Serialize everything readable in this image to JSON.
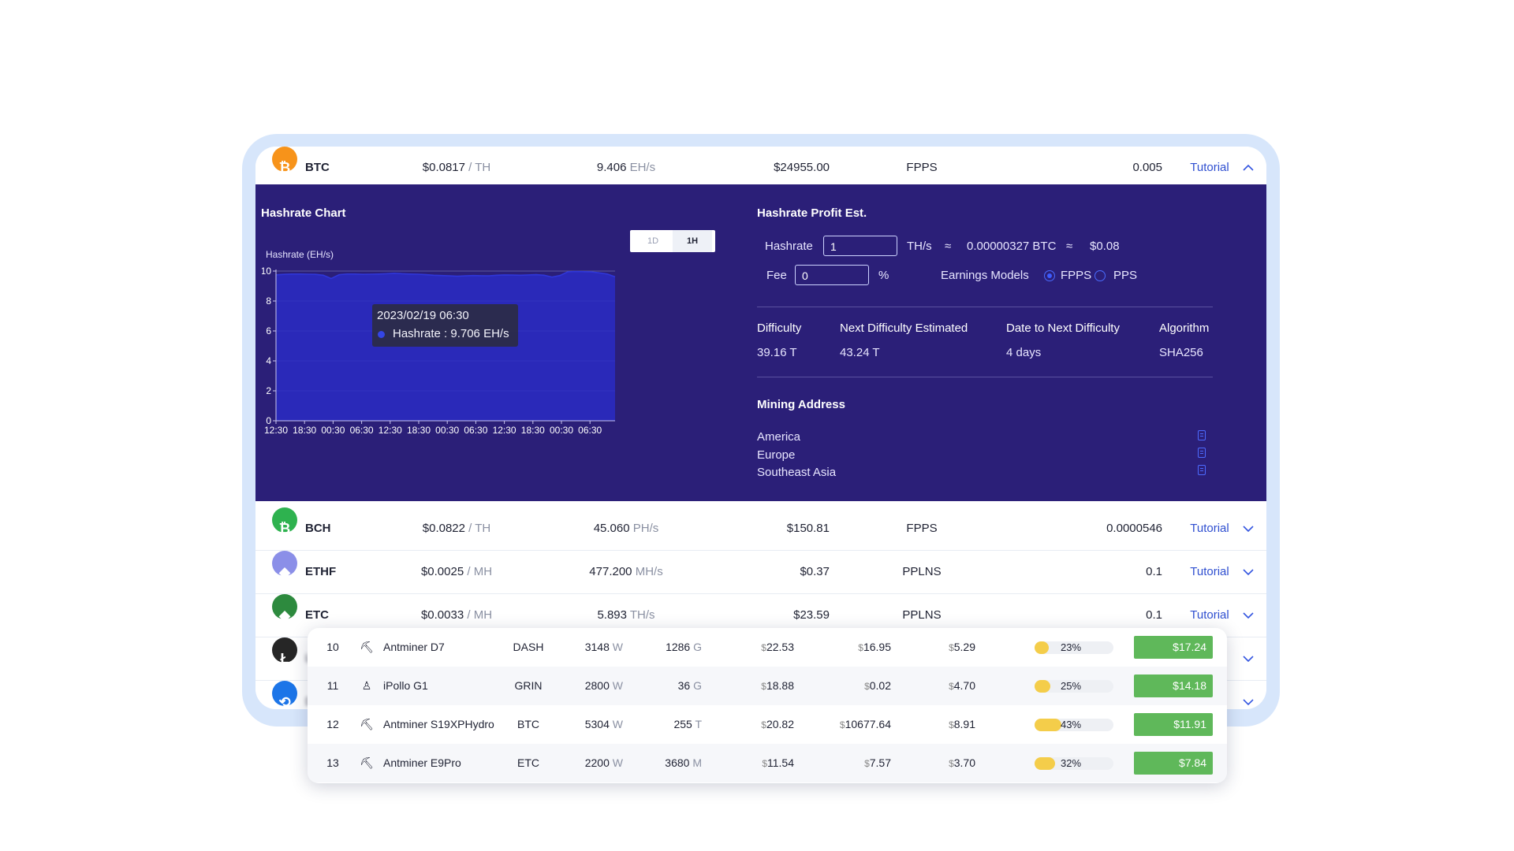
{
  "coins": [
    {
      "name": "BTC",
      "price": "$0.0817",
      "price_unit": "/ TH",
      "hashrate": "9.406",
      "hashrate_unit": "EH/s",
      "usd": "$24955.00",
      "model": "FPPS",
      "min_payout": "0.005",
      "tutorial": "Tutorial",
      "chevron": "^",
      "icon": "bitcoin-icon",
      "color": "#f7931a",
      "glyph": "₿"
    },
    {
      "name": "BCH",
      "price": "$0.0822",
      "price_unit": "/ TH",
      "hashrate": "45.060",
      "hashrate_unit": "PH/s",
      "usd": "$150.81",
      "model": "FPPS",
      "min_payout": "0.0000546",
      "tutorial": "Tutorial",
      "chevron": "v",
      "icon": "bitcoin-cash-icon",
      "color": "#2eb24f",
      "glyph": "₿"
    },
    {
      "name": "ETHF",
      "price": "$0.0025",
      "price_unit": "/ MH",
      "hashrate": "477.200",
      "hashrate_unit": "MH/s",
      "usd": "$0.37",
      "model": "PPLNS",
      "min_payout": "0.1",
      "tutorial": "Tutorial",
      "chevron": "v",
      "icon": "ethereum-fair-icon",
      "color": "#8b8fe8",
      "glyph": "◆"
    },
    {
      "name": "ETC",
      "price": "$0.0033",
      "price_unit": "/ MH",
      "hashrate": "5.893",
      "hashrate_unit": "TH/s",
      "usd": "$23.59",
      "model": "PPLNS",
      "min_payout": "0.1",
      "tutorial": "Tutorial",
      "chevron": "v",
      "icon": "ethereum-classic-icon",
      "color": "#2d8a3e",
      "glyph": "◆"
    },
    {
      "name": "L",
      "price": "",
      "price_unit": "",
      "hashrate": "",
      "hashrate_unit": "",
      "usd": "",
      "model": "",
      "min_payout": "",
      "tutorial": "",
      "chevron": "v",
      "icon": "litecoin-icon",
      "color": "#262626",
      "glyph": "Ł"
    },
    {
      "name": "D",
      "price": "",
      "price_unit": "",
      "hashrate": "",
      "hashrate_unit": "",
      "usd": "",
      "model": "",
      "min_payout": "",
      "tutorial": "",
      "chevron": "v",
      "icon": "dash-icon",
      "color": "#1c75e8",
      "glyph": "⟲"
    }
  ],
  "hashrate_chart": {
    "panel_title": "Hashrate Chart",
    "timeframes": [
      "1D",
      "1H"
    ],
    "selected_timeframe": "1H",
    "tooltip": {
      "date": "2023/02/19 06:30",
      "series_label": "Hashrate : 9.706 EH/s"
    }
  },
  "chart_data": {
    "type": "area",
    "title": "",
    "ylabel": "Hashrate (EH/s)",
    "xlabel": "",
    "ylim": [
      0,
      10
    ],
    "yticks": [
      0,
      2,
      4,
      6,
      8,
      10
    ],
    "x_tick_labels": [
      "12:30",
      "18:30",
      "00:30",
      "06:30",
      "12:30",
      "18:30",
      "00:30",
      "06:30",
      "12:30",
      "18:30",
      "00:30",
      "06:30"
    ],
    "series": [
      {
        "values": [
          9.75,
          9.78,
          9.8,
          9.8,
          9.79,
          9.78,
          9.72,
          9.5,
          9.76,
          9.8,
          9.8,
          9.78,
          9.79,
          9.8,
          9.82,
          9.85,
          9.82,
          9.8,
          9.79,
          9.76,
          9.72,
          9.7,
          9.68,
          9.65,
          9.68,
          9.7,
          9.69,
          9.68,
          9.72,
          9.74,
          9.73,
          9.72,
          9.74,
          9.76,
          9.72,
          9.6,
          9.7,
          9.95,
          9.97,
          9.96,
          9.94,
          9.88,
          9.8,
          9.62
        ]
      }
    ],
    "colors": {
      "fill": "#2a2cc4",
      "line": "#2f36d8",
      "grid": "#5c5a9c"
    }
  },
  "profit_est": {
    "title": "Hashrate Profit Est.",
    "hashrate_label": "Hashrate",
    "hashrate_value": "1",
    "hashrate_unit": "TH/s",
    "approx1": "≈",
    "btc_value": "0.00000327 BTC",
    "approx2": "≈",
    "usd_value": "$0.08",
    "fee_label": "Fee",
    "fee_value": "0",
    "fee_unit": "%",
    "earnings_label": "Earnings Models",
    "model_options": [
      "FPPS",
      "PPS"
    ],
    "selected_model": "FPPS"
  },
  "difficulty": {
    "headers": [
      "Difficulty",
      "Next Difficulty Estimated",
      "Date to Next Difficulty",
      "Algorithm"
    ],
    "values": [
      "39.16 T",
      "43.24 T",
      "4 days",
      "SHA256"
    ]
  },
  "mining_address": {
    "title": "Mining Address",
    "regions": [
      "America",
      "Europe",
      "Southeast Asia"
    ]
  },
  "miners": [
    {
      "idx": "10",
      "icon": "pickaxe-icon",
      "glyph": "⛏",
      "name": "Antminer D7",
      "coin": "DASH",
      "power": "3148",
      "power_unit": "W",
      "hashrate": "1286",
      "hashrate_unit": "G",
      "revenue": "22.53",
      "cost": "16.95",
      "profit": "5.29",
      "pct": "23%",
      "pct_value": 0.23,
      "best": "$17.24"
    },
    {
      "idx": "11",
      "icon": "ipollo-icon",
      "glyph": "♙",
      "name": "iPollo G1",
      "coin": "GRIN",
      "power": "2800",
      "power_unit": "W",
      "hashrate": "36",
      "hashrate_unit": "G",
      "revenue": "18.88",
      "cost": "0.02",
      "profit": "4.70",
      "pct": "25%",
      "pct_value": 0.25,
      "best": "$14.18"
    },
    {
      "idx": "12",
      "icon": "pickaxe-icon",
      "glyph": "⛏",
      "name": "Antminer S19XPHydro",
      "coin": "BTC",
      "power": "5304",
      "power_unit": "W",
      "hashrate": "255",
      "hashrate_unit": "T",
      "revenue": "20.82",
      "cost": "10677.64",
      "profit": "8.91",
      "pct": "43%",
      "pct_value": 0.43,
      "best": "$11.91"
    },
    {
      "idx": "13",
      "icon": "pickaxe-icon",
      "glyph": "⛏",
      "name": "Antminer E9Pro",
      "coin": "ETC",
      "power": "2200",
      "power_unit": "W",
      "hashrate": "3680",
      "hashrate_unit": "M",
      "revenue": "11.54",
      "cost": "7.57",
      "profit": "3.70",
      "pct": "32%",
      "pct_value": 0.32,
      "best": "$7.84"
    }
  ],
  "currency_symbol": "$"
}
